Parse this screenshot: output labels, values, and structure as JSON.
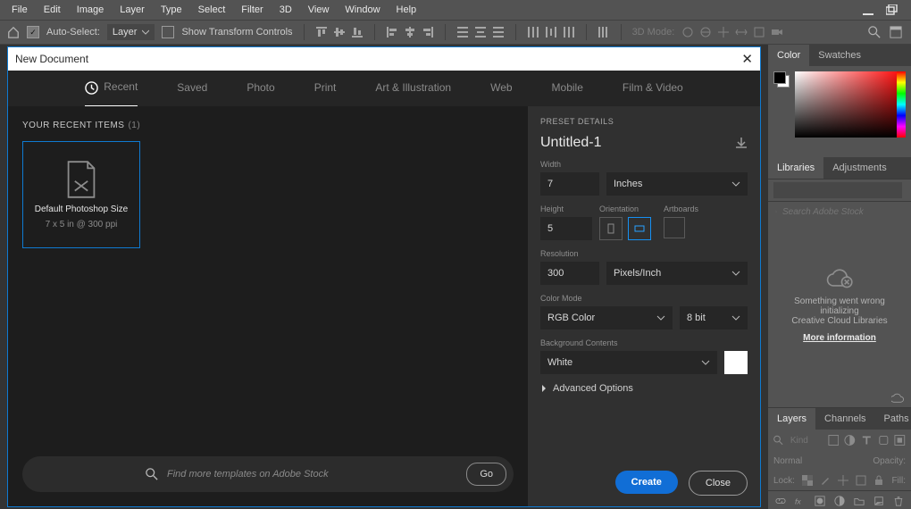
{
  "menu": {
    "file": "File",
    "edit": "Edit",
    "image": "Image",
    "layer": "Layer",
    "type": "Type",
    "select": "Select",
    "filter": "Filter",
    "threeD": "3D",
    "view": "View",
    "window": "Window",
    "help": "Help"
  },
  "options": {
    "autoSelect": "Auto-Select:",
    "layerSel": "Layer",
    "showTransform": "Show Transform Controls",
    "mode": "3D Mode:"
  },
  "panels": {
    "color": "Color",
    "swatches": "Swatches",
    "libraries": "Libraries",
    "adjustments": "Adjustments",
    "libSearchPlaceholder": "Search Adobe Stock",
    "libError1": "Something went wrong initializing",
    "libError2": "Creative Cloud Libraries",
    "libLink": "More information",
    "layers": "Layers",
    "channels": "Channels",
    "paths": "Paths",
    "kindPlaceholder": "Kind",
    "blendMode": "Normal",
    "opacityLabel": "Opacity:",
    "lockLabel": "Lock:",
    "fillLabel": "Fill:"
  },
  "dialog": {
    "title": "New Document",
    "tabs": {
      "recent": "Recent",
      "saved": "Saved",
      "photo": "Photo",
      "print": "Print",
      "art": "Art & Illustration",
      "web": "Web",
      "mobile": "Mobile",
      "film": "Film & Video"
    },
    "recentHead": "YOUR RECENT ITEMS",
    "recentCount": "(1)",
    "preset": {
      "title": "Default Photoshop Size",
      "sub": "7 x 5 in @ 300 ppi"
    },
    "stockPlaceholder": "Find more templates on Adobe Stock",
    "go": "Go",
    "pdHead": "PRESET DETAILS",
    "docTitle": "Untitled-1",
    "widthLabel": "Width",
    "widthVal": "7",
    "widthUnit": "Inches",
    "heightLabel": "Height",
    "heightVal": "5",
    "orientLabel": "Orientation",
    "artboardsLabel": "Artboards",
    "resLabel": "Resolution",
    "resVal": "300",
    "resUnit": "Pixels/Inch",
    "colorModeLabel": "Color Mode",
    "colorMode": "RGB Color",
    "colorDepth": "8 bit",
    "bgLabel": "Background Contents",
    "bgVal": "White",
    "advanced": "Advanced Options",
    "create": "Create",
    "close": "Close"
  }
}
